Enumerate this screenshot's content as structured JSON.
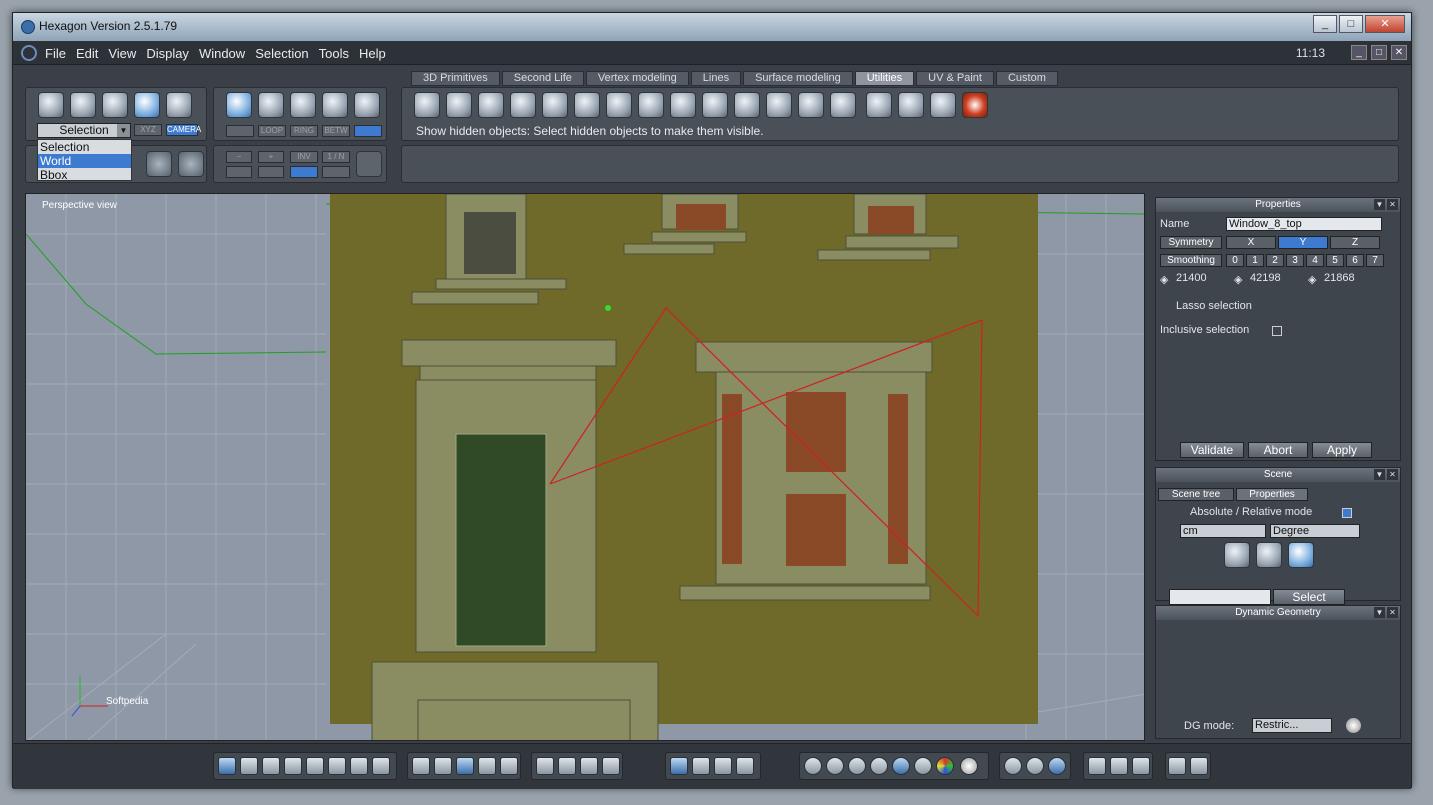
{
  "window": {
    "title": "Hexagon Version 2.5.1.79",
    "clock": "11:13",
    "controls": [
      "_",
      "□",
      "✕"
    ]
  },
  "menu": {
    "items": [
      "File",
      "Edit",
      "View",
      "Display",
      "Window",
      "Selection",
      "Tools",
      "Help"
    ]
  },
  "tabs": [
    "3D Primitives",
    "Second Life",
    "Vertex modeling",
    "Lines",
    "Surface modeling",
    "Utilities",
    "UV & Paint",
    "Custom"
  ],
  "active_tab": "Utilities",
  "toolbar": {
    "selection_value": "Selection",
    "dropdown_options": [
      "Selection",
      "World",
      "Bbox"
    ],
    "dropdown_highlight": "World",
    "xyz_label": "XYZ",
    "camera_label": "CAMERA",
    "loop_label": "LOOP",
    "ring_label": "RING",
    "betw_label": "BETW",
    "minus_label": "−",
    "plus_label": "+",
    "inv_label": "INV",
    "one_n_label": "1 / N",
    "hint": "Show hidden objects: Select hidden objects to make them visible."
  },
  "viewport": {
    "label": "Perspective view",
    "axis_label": "Softpedia"
  },
  "properties": {
    "title": "Properties",
    "name_label": "Name",
    "name_value": "Window_8_top",
    "symmetry_label": "Symmetry",
    "sym_axes": [
      "X",
      "Y",
      "Z"
    ],
    "sym_active": "Y",
    "smoothing_label": "Smoothing",
    "smoothing_levels": [
      "0",
      "1",
      "2",
      "3",
      "4",
      "5",
      "6",
      "7"
    ],
    "counts": [
      "21400",
      "42198",
      "21868"
    ],
    "lasso": "Lasso selection",
    "inclusive": "Inclusive selection",
    "validate": "Validate",
    "abort": "Abort",
    "apply": "Apply"
  },
  "scene": {
    "title": "Scene",
    "tab_tree": "Scene tree",
    "tab_props": "Properties",
    "mode_label": "Absolute / Relative mode",
    "unit": "cm",
    "angle": "Degree",
    "select_btn": "Select"
  },
  "dynamic": {
    "title": "Dynamic Geometry",
    "dg_label": "DG mode:",
    "dg_value": "Restric..."
  },
  "colors": {
    "accent": "#3d7bd0",
    "building": "#6f6a2a",
    "grid": "#8e98a6",
    "selection_line": "#d02020"
  }
}
